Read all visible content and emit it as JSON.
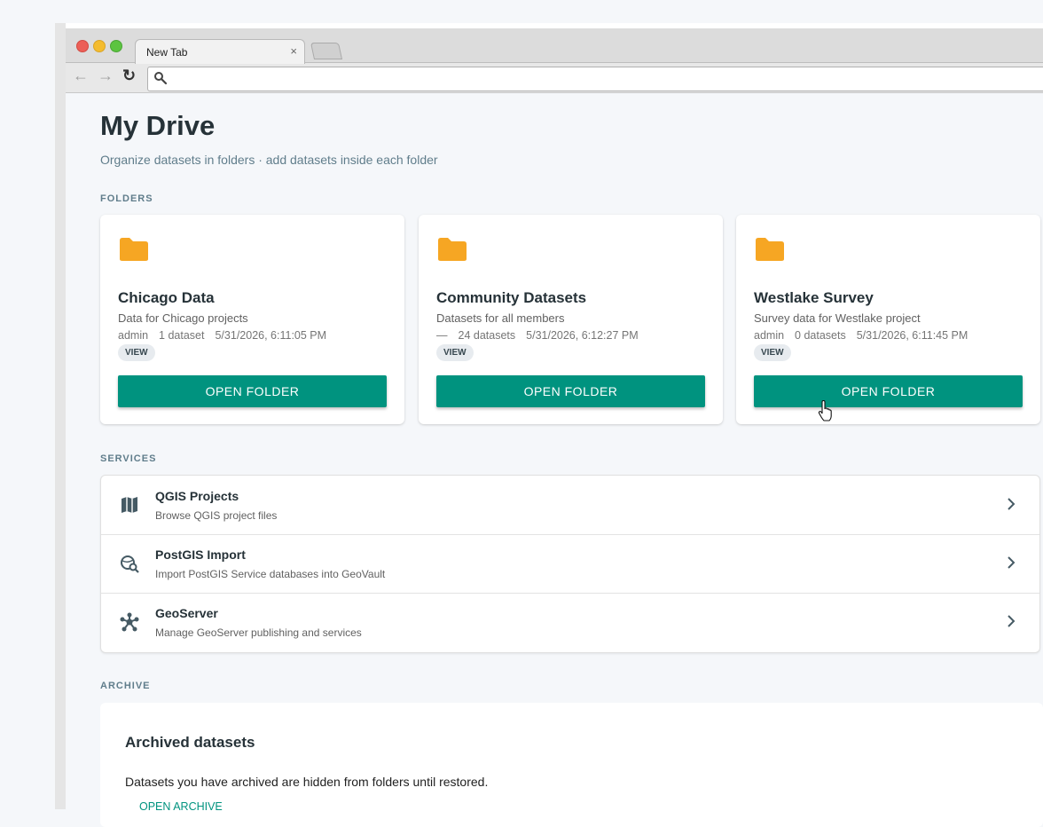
{
  "browser": {
    "tab_title": "New Tab",
    "tab_close": "×",
    "address": ""
  },
  "page": {
    "title": "My Drive",
    "subtitle": "Organize datasets in folders · add datasets inside each folder"
  },
  "sections": {
    "folders": "FOLDERS",
    "services": "SERVICES",
    "archive": "ARCHIVE"
  },
  "folders": [
    {
      "name": "Chicago Data",
      "description": "Data for Chicago projects",
      "owner": "admin",
      "count": "1 dataset",
      "date": "5/31/2026, 6:11:05 PM",
      "chip": "VIEW",
      "button": "OPEN FOLDER"
    },
    {
      "name": "Community Datasets",
      "description": "Datasets for all members",
      "owner": "—",
      "count": "24 datasets",
      "date": "5/31/2026, 6:12:27 PM",
      "chip": "VIEW",
      "button": "OPEN FOLDER"
    },
    {
      "name": "Westlake Survey",
      "description": "Survey data for Westlake project",
      "owner": "admin",
      "count": "0 datasets",
      "date": "5/31/2026, 6:11:45 PM",
      "chip": "VIEW",
      "button": "OPEN FOLDER"
    }
  ],
  "services": [
    {
      "title": "QGIS Projects",
      "subtitle": "Browse QGIS project files",
      "icon": "map-icon"
    },
    {
      "title": "PostGIS Import",
      "subtitle": "Import PostGIS Service databases into GeoVault",
      "icon": "globe-search-icon"
    },
    {
      "title": "GeoServer",
      "subtitle": "Manage GeoServer publishing and services",
      "icon": "hub-icon"
    }
  ],
  "archive": {
    "title": "Archived datasets",
    "text": "Datasets you have archived are hidden from folders until restored.",
    "link": "OPEN ARCHIVE"
  },
  "colors": {
    "accent": "#00937f",
    "folder": "#f6a623",
    "title_text": "#263238",
    "muted_text": "#607d8b"
  }
}
